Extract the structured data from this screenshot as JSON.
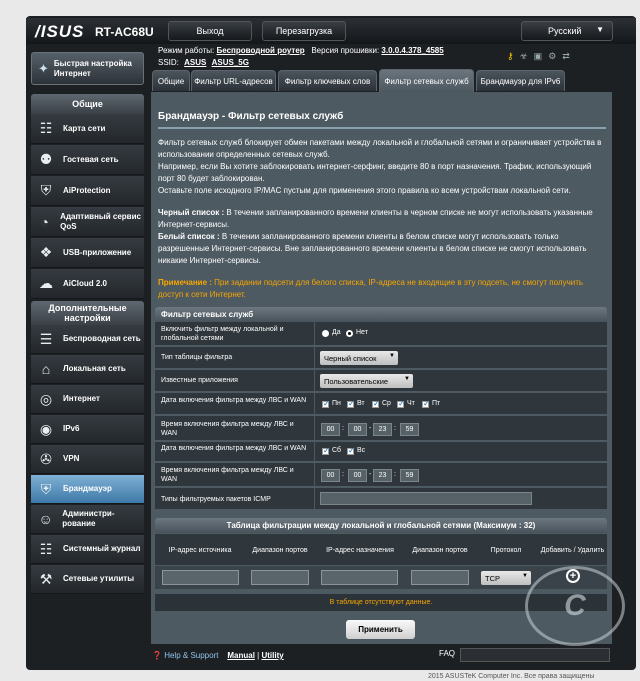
{
  "header": {
    "logo": "/ISUS",
    "model": "RT-AC68U",
    "logout": "Выход",
    "reboot": "Перезагрузка",
    "language": "Русский"
  },
  "status": {
    "mode_label": "Режим работы:",
    "mode_value": "Беспроводной роутер",
    "fw_label": "Версия прошивки:",
    "fw_value": "3.0.0.4.378_4585",
    "ssid_label": "SSID:",
    "ssid_1": "ASUS",
    "ssid_2": "ASUS_5G"
  },
  "sidebar": {
    "quick": "Быстрая настройка Интернет",
    "general_header": "Общие",
    "general": [
      {
        "label": "Карта сети",
        "icon": "network-map-icon"
      },
      {
        "label": "Гостевая сеть",
        "icon": "guest-network-icon"
      },
      {
        "label": "AiProtection",
        "icon": "aiprotection-icon"
      },
      {
        "label": "Адаптивный сервис QoS",
        "icon": "qos-icon"
      },
      {
        "label": "USB-приложение",
        "icon": "usb-app-icon"
      },
      {
        "label": "AiCloud 2.0",
        "icon": "aicloud-icon"
      }
    ],
    "advanced_header": "Дополнительные настройки",
    "advanced": [
      {
        "label": "Беспроводная сеть",
        "icon": "wireless-icon"
      },
      {
        "label": "Локальная сеть",
        "icon": "lan-icon"
      },
      {
        "label": "Интернет",
        "icon": "wan-icon"
      },
      {
        "label": "IPv6",
        "icon": "ipv6-icon"
      },
      {
        "label": "VPN",
        "icon": "vpn-icon"
      },
      {
        "label": "Брандмауэр",
        "icon": "firewall-icon"
      },
      {
        "label": "Администри-рование",
        "icon": "administration-icon"
      },
      {
        "label": "Системный журнал",
        "icon": "system-log-icon"
      },
      {
        "label": "Сетевые утилиты",
        "icon": "network-tools-icon"
      }
    ]
  },
  "tabs": [
    "Общие",
    "Фильтр URL-адресов",
    "Фильтр ключевых слов",
    "Фильтр сетевых служб",
    "Брандмауэр для IPv6"
  ],
  "page": {
    "title": "Брандмауэр - Фильтр сетевых служб",
    "desc1": "Фильтр сетевых служб блокирует обмен пакетами между локальной и глобальной сетями и ограничивает устройства в использовании определенных сетевых служб.",
    "desc2": "Например, если Вы хотите заблокировать интернет-серфинг, введите 80 в порт назначения. Трафик, использующий порт 80 будет заблокирован.",
    "desc3": "Оставьте поле исходного IP/MAC пустым для применения этого правила ко всем устройствам локальной сети.",
    "black_label": "Черный список :",
    "black_text": " В течении запланированного времени клиенты в черном списке не могут использовать указанные Интернет-сервисы.",
    "white_label": "Белый список :",
    "white_text": " В течении запланированного времени клиенты в белом списке могут использовать только разрешенные Интернет-сервисы. Вне запланированного времени клиенты в белом списке не смогут использовать никакие Интернет-сервисы.",
    "note_label": "Примечание :",
    "note_text": " При задании подсети для белого списка, IP-адреса не входящие в эту подсеть, не смогут получить доступ к сети Интернет."
  },
  "filter_table": {
    "header": "Фильтр сетевых служб",
    "enable_label": "Включить фильтр между локальной и глобальной сетями",
    "yes": "Да",
    "no": "Нет",
    "type_label": "Тип таблицы фильтра",
    "type_value": "Черный список",
    "apps_label": "Известные приложения",
    "apps_value": "Пользовательские",
    "days1_label": "Дата включения фильтра между ЛВС и WAN",
    "days1": [
      "Пн",
      "Вт",
      "Ср",
      "Чт",
      "Пт"
    ],
    "time1_label": "Время включения фильтра между ЛВС и WAN",
    "time1": [
      "00",
      "00",
      "23",
      "59"
    ],
    "days2_label": "Дата включения фильтра между ЛВС и WAN",
    "days2": [
      "Сб",
      "Вс"
    ],
    "time2_label": "Время включения фильтра между ЛВС и WAN",
    "time2": [
      "00",
      "00",
      "23",
      "59"
    ],
    "icmp_label": "Типы фильтруемых пакетов ICMP"
  },
  "rules_table": {
    "header": "Таблица фильтрации между локальной и глобальной сетями (Максимум : 32)",
    "columns": [
      "IP-адрес источника",
      "Диапазон портов",
      "IP-адрес назначения",
      "Диапазон портов",
      "Протокол",
      "Добавить / Удалить"
    ],
    "protocol": "TCP",
    "empty": "В таблице отсутствуют данные."
  },
  "apply": "Применить",
  "footer": {
    "help": "Help & Support",
    "manual": "Manual",
    "sep": "|",
    "utility": "Utility",
    "faq": "FAQ",
    "copyright": "2015 ASUSTeK Computer Inc. Все права защищены"
  }
}
